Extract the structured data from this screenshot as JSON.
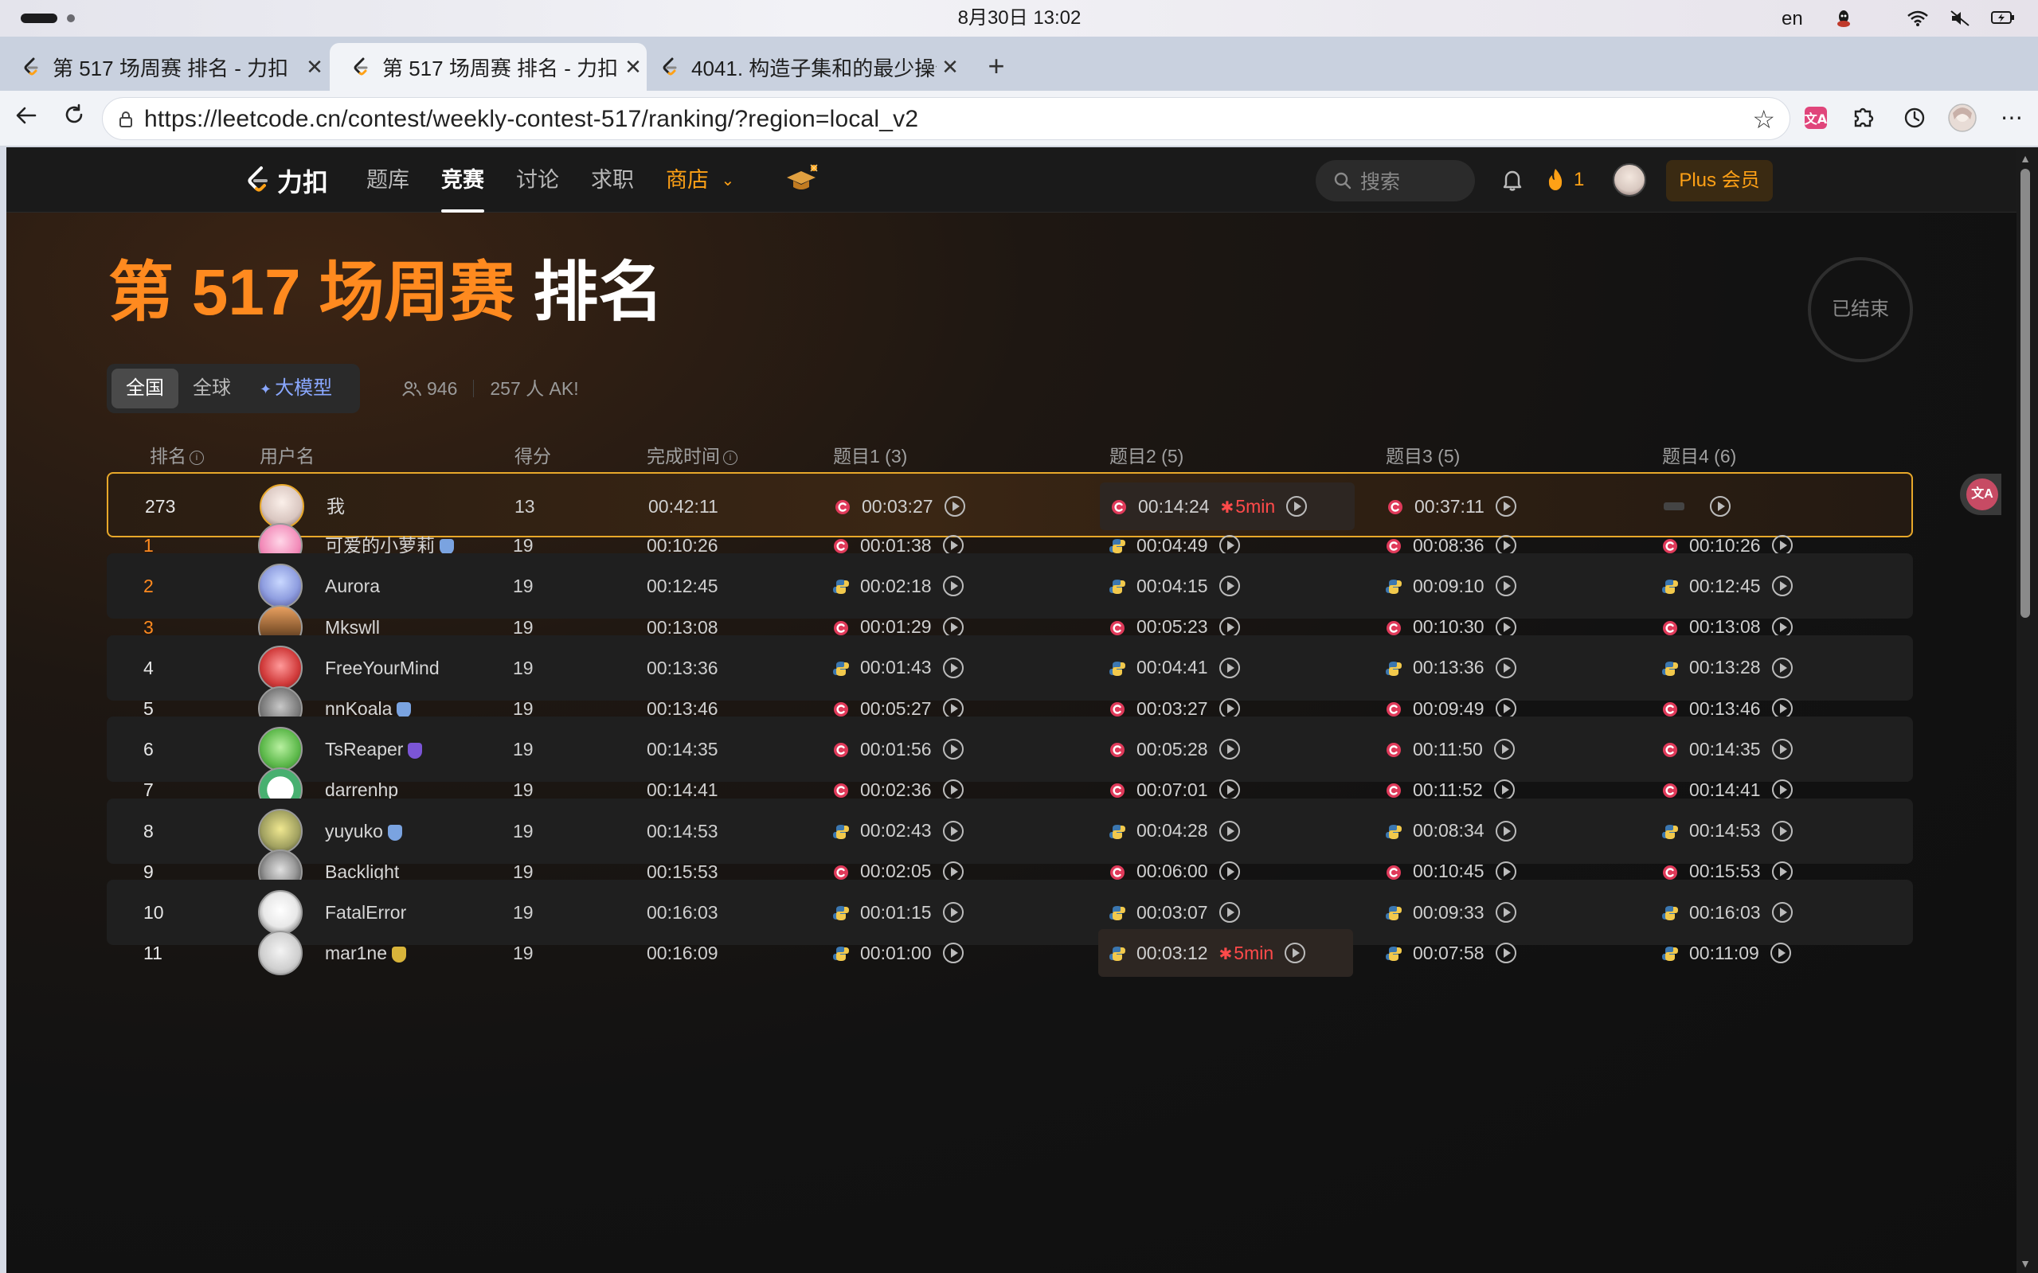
{
  "os": {
    "clock": "8月30日 13:02",
    "input_lang": "en"
  },
  "browser": {
    "tabs": [
      {
        "title": "第 517 场周赛 排名 - 力扣",
        "active": false
      },
      {
        "title": "第 517 场周赛 排名 - 力扣",
        "active": true
      },
      {
        "title": "4041. 构造子集和的最少操作",
        "active": false
      }
    ],
    "url": "https://leetcode.cn/contest/weekly-contest-517/ranking/?region=local_v2"
  },
  "site": {
    "logo_text": "力扣",
    "nav": [
      "题库",
      "竞赛",
      "讨论",
      "求职",
      "商店"
    ],
    "search_placeholder": "搜索",
    "streak": "1",
    "plus_label": "Plus 会员"
  },
  "contest": {
    "title_orange": "第 517 场周赛",
    "title_white": "排名",
    "status": "已结束",
    "regions": [
      "全国",
      "全球",
      "大模型"
    ],
    "participants": "946",
    "ak": "257 人 AK!"
  },
  "table": {
    "headers": [
      "排名",
      "用户名",
      "得分",
      "完成时间",
      "题目1 (3)",
      "题目2 (5)",
      "题目3 (5)",
      "题目4 (6)"
    ],
    "rows": [
      {
        "rank": "273",
        "name": "我",
        "score": "13",
        "time": "00:42:11",
        "me": true,
        "q": [
          {
            "lang": "c",
            "t": "00:03:27"
          },
          {
            "lang": "c",
            "t": "00:14:24",
            "pen": "5min"
          },
          {
            "lang": "c",
            "t": "00:37:11"
          },
          {
            "lang": "none",
            "t": ""
          }
        ]
      },
      {
        "rank": "1",
        "name": "可爱的小萝莉",
        "badge": "#7aa3e0",
        "score": "19",
        "time": "00:10:26",
        "q": [
          {
            "lang": "c",
            "t": "00:01:38"
          },
          {
            "lang": "py",
            "t": "00:04:49"
          },
          {
            "lang": "c",
            "t": "00:08:36"
          },
          {
            "lang": "c",
            "t": "00:10:26"
          }
        ]
      },
      {
        "rank": "2",
        "name": "Aurora",
        "score": "19",
        "time": "00:12:45",
        "q": [
          {
            "lang": "py",
            "t": "00:02:18"
          },
          {
            "lang": "py",
            "t": "00:04:15"
          },
          {
            "lang": "py",
            "t": "00:09:10"
          },
          {
            "lang": "py",
            "t": "00:12:45"
          }
        ]
      },
      {
        "rank": "3",
        "name": "Mkswll",
        "score": "19",
        "time": "00:13:08",
        "q": [
          {
            "lang": "c",
            "t": "00:01:29"
          },
          {
            "lang": "c",
            "t": "00:05:23"
          },
          {
            "lang": "c",
            "t": "00:10:30"
          },
          {
            "lang": "c",
            "t": "00:13:08"
          }
        ]
      },
      {
        "rank": "4",
        "name": "FreeYourMind",
        "score": "19",
        "time": "00:13:36",
        "q": [
          {
            "lang": "py",
            "t": "00:01:43"
          },
          {
            "lang": "py",
            "t": "00:04:41"
          },
          {
            "lang": "py",
            "t": "00:13:36"
          },
          {
            "lang": "py",
            "t": "00:13:28"
          }
        ]
      },
      {
        "rank": "5",
        "name": "nnKoala",
        "badge": "#7aa3e0",
        "score": "19",
        "time": "00:13:46",
        "q": [
          {
            "lang": "c",
            "t": "00:05:27"
          },
          {
            "lang": "c",
            "t": "00:03:27"
          },
          {
            "lang": "c",
            "t": "00:09:49"
          },
          {
            "lang": "c",
            "t": "00:13:46"
          }
        ]
      },
      {
        "rank": "6",
        "name": "TsReaper",
        "badge": "#7b55d6",
        "score": "19",
        "time": "00:14:35",
        "q": [
          {
            "lang": "c",
            "t": "00:01:56"
          },
          {
            "lang": "c",
            "t": "00:05:28"
          },
          {
            "lang": "c",
            "t": "00:11:50"
          },
          {
            "lang": "c",
            "t": "00:14:35"
          }
        ]
      },
      {
        "rank": "7",
        "name": "darrenhp",
        "score": "19",
        "time": "00:14:41",
        "q": [
          {
            "lang": "c",
            "t": "00:02:36"
          },
          {
            "lang": "c",
            "t": "00:07:01"
          },
          {
            "lang": "c",
            "t": "00:11:52"
          },
          {
            "lang": "c",
            "t": "00:14:41"
          }
        ]
      },
      {
        "rank": "8",
        "name": "yuyuko",
        "badge": "#7aa3e0",
        "score": "19",
        "time": "00:14:53",
        "q": [
          {
            "lang": "py",
            "t": "00:02:43"
          },
          {
            "lang": "py",
            "t": "00:04:28"
          },
          {
            "lang": "py",
            "t": "00:08:34"
          },
          {
            "lang": "py",
            "t": "00:14:53"
          }
        ]
      },
      {
        "rank": "9",
        "name": "Backlight",
        "score": "19",
        "time": "00:15:53",
        "q": [
          {
            "lang": "c",
            "t": "00:02:05"
          },
          {
            "lang": "c",
            "t": "00:06:00"
          },
          {
            "lang": "c",
            "t": "00:10:45"
          },
          {
            "lang": "c",
            "t": "00:15:53"
          }
        ]
      },
      {
        "rank": "10",
        "name": "FatalError",
        "score": "19",
        "time": "00:16:03",
        "q": [
          {
            "lang": "py",
            "t": "00:01:15"
          },
          {
            "lang": "py",
            "t": "00:03:07"
          },
          {
            "lang": "py",
            "t": "00:09:33"
          },
          {
            "lang": "py",
            "t": "00:16:03"
          }
        ]
      },
      {
        "rank": "11",
        "name": "mar1ne",
        "badge": "#d8b43a",
        "score": "19",
        "time": "00:16:09",
        "q": [
          {
            "lang": "py",
            "t": "00:01:00"
          },
          {
            "lang": "py",
            "t": "00:03:12",
            "pen": "5min"
          },
          {
            "lang": "py",
            "t": "00:07:58"
          },
          {
            "lang": "py",
            "t": "00:11:09"
          }
        ]
      }
    ]
  },
  "colors": {
    "accent": "#ffa116",
    "title_orange": "#ff8a1f",
    "penalty": "#ff4a4a",
    "me_border": "#e8a82a"
  }
}
